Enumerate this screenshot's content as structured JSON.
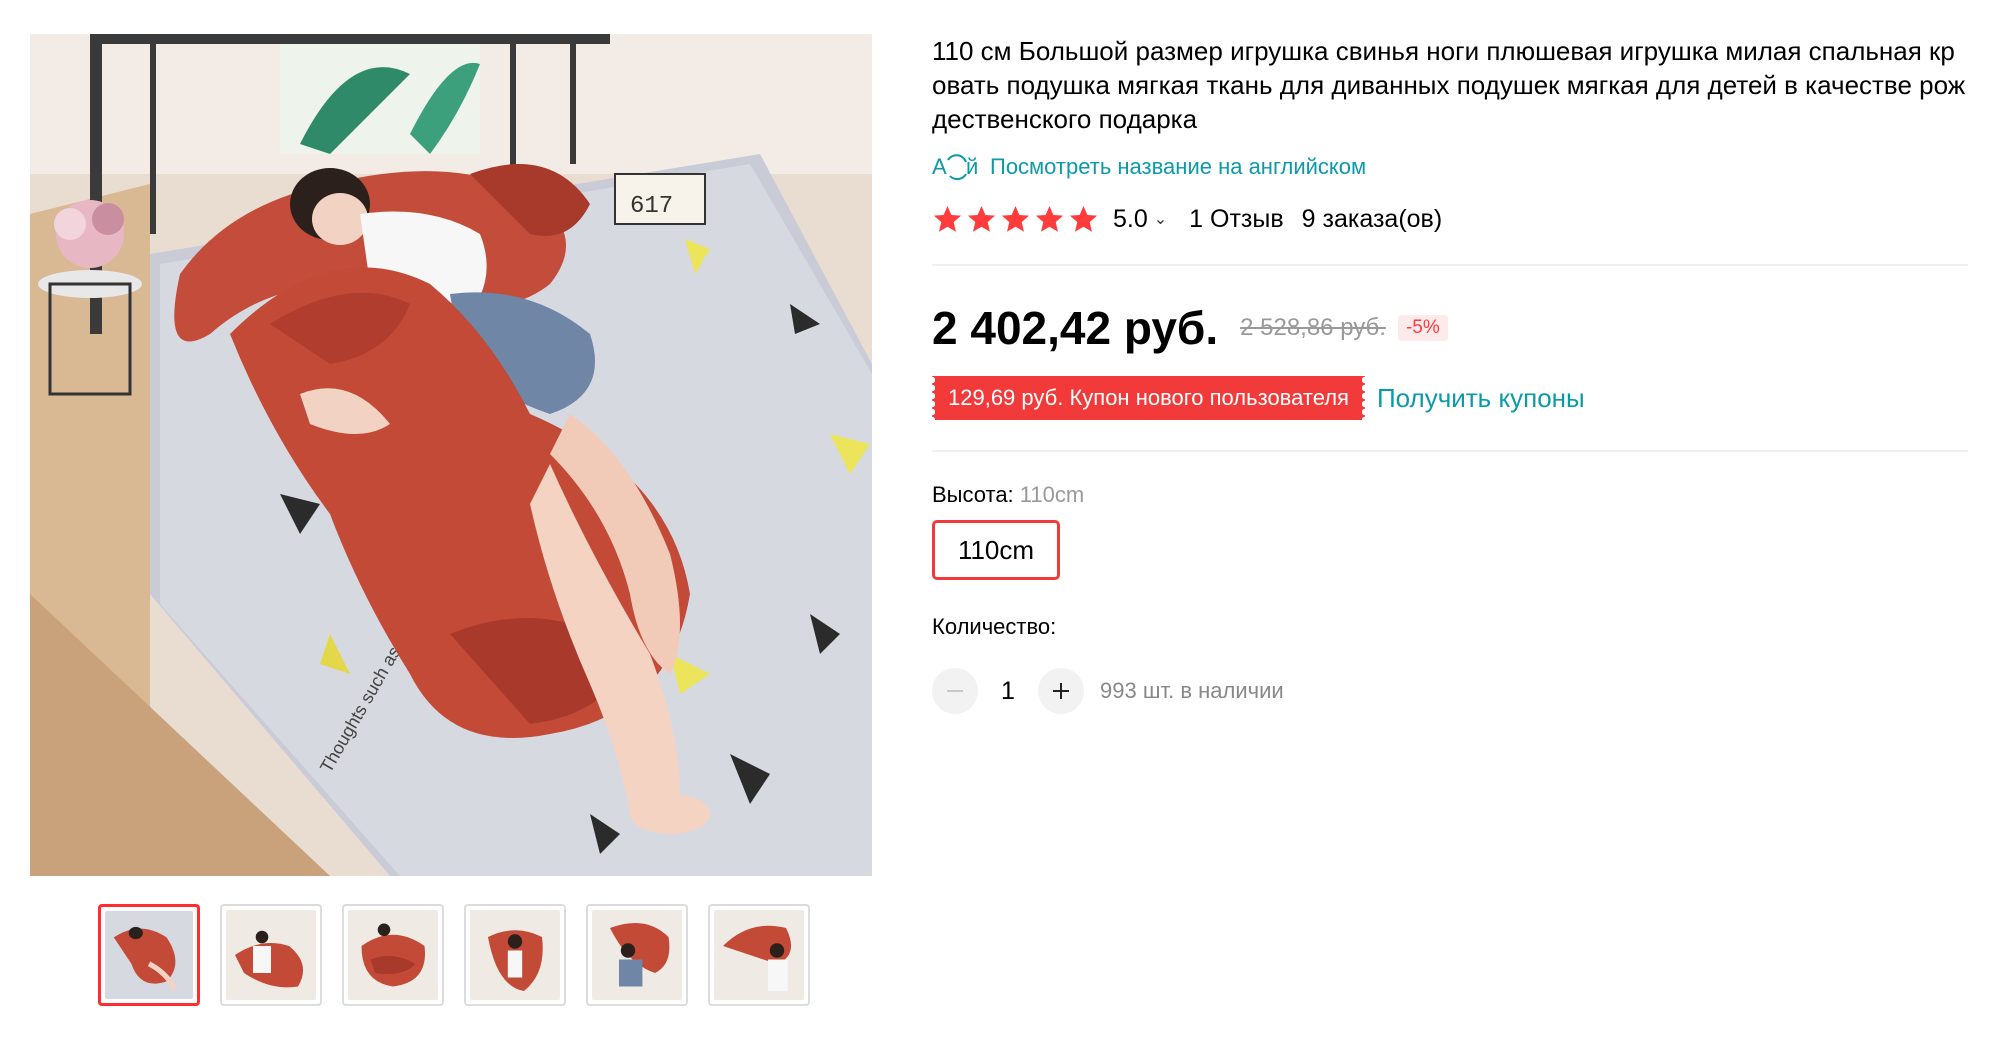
{
  "product": {
    "title": "110 см Большой размер игрушка свинья ноги плюшевая игрушка милая спальная кровать подушка мягкая ткань для диванных подушек мягкая для детей в качестве рождественского подарка",
    "translate_link": "Посмотреть название на английском",
    "translate_icon_text": "A",
    "translate_icon_text2": "й"
  },
  "rating": {
    "value": "5.0",
    "stars": 5,
    "reviews": "1 Отзыв",
    "orders": "9 заказа(ов)"
  },
  "price": {
    "current": "2 402,42 руб.",
    "old": "2 528,86 руб.",
    "discount": "-5%"
  },
  "coupon": {
    "badge": "129,69 руб. Купон нового пользователя",
    "link": "Получить купоны"
  },
  "properties": {
    "height_label": "Высота:",
    "height_value": "110cm",
    "option": "110cm"
  },
  "quantity": {
    "label": "Количество:",
    "value": "1",
    "stock": "993 шт. в наличии"
  },
  "sticker_text": "Thoughts such as love",
  "calendar_text": "617",
  "gallery": {
    "thumbnail_count": 6,
    "active_index": 0
  },
  "colors": {
    "accent_red": "#f23a3a",
    "link_teal": "#0c9aa9",
    "star_red": "#ff3b3b"
  }
}
